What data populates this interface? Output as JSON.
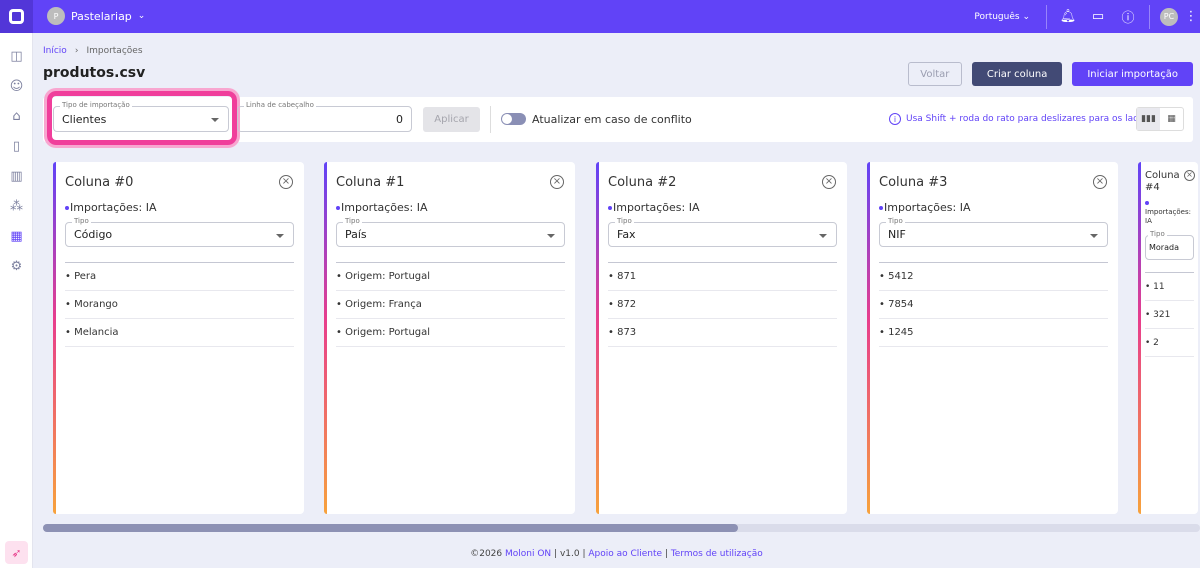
{
  "topbar": {
    "org_initial": "P",
    "org_name": "Pastelariap",
    "language": "Português",
    "user_initials": "PC"
  },
  "breadcrumb": {
    "home": "Início",
    "current": "Importações"
  },
  "title": "produtos.csv",
  "buttons": {
    "back": "Voltar",
    "create_column": "Criar coluna",
    "start_import": "Iniciar importação"
  },
  "toolbar": {
    "import_type_label": "Tipo de importação",
    "import_type_value": "Clientes",
    "header_row_label": "Linha de cabeçalho",
    "header_row_value": "0",
    "apply": "Aplicar",
    "conflict_toggle_label": "Atualizar em caso de conflito",
    "conflict_toggle_on": false,
    "hint": "Usa Shift + roda do rato para deslizares para os lados",
    "view_mode": "columns"
  },
  "columns": [
    {
      "title": "Coluna #0",
      "source": "Importações: IA",
      "type_label": "Tipo",
      "type": "Código",
      "values": [
        "Pera",
        "Morango",
        "Melancia"
      ]
    },
    {
      "title": "Coluna #1",
      "source": "Importações: IA",
      "type_label": "Tipo",
      "type": "País",
      "values": [
        "Origem: Portugal",
        "Origem: França",
        "Origem: Portugal"
      ]
    },
    {
      "title": "Coluna #2",
      "source": "Importações: IA",
      "type_label": "Tipo",
      "type": "Fax",
      "values": [
        "871",
        "872",
        "873"
      ]
    },
    {
      "title": "Coluna #3",
      "source": "Importações: IA",
      "type_label": "Tipo",
      "type": "NIF",
      "values": [
        "5412",
        "7854",
        "1245"
      ]
    },
    {
      "title": "Coluna #4",
      "source": "Importações: IA",
      "type_label": "Tipo",
      "type": "Morada",
      "values": [
        "11",
        "321",
        "2"
      ]
    }
  ],
  "footer": {
    "copyright": "©2026",
    "brand": "Moloni ON",
    "version": "v1.0",
    "support": "Apoio ao Cliente",
    "terms": "Termos de utilização"
  },
  "colors": {
    "primary": "#6143f7",
    "dark_button": "#424a75",
    "highlight": "#f03e9b"
  }
}
